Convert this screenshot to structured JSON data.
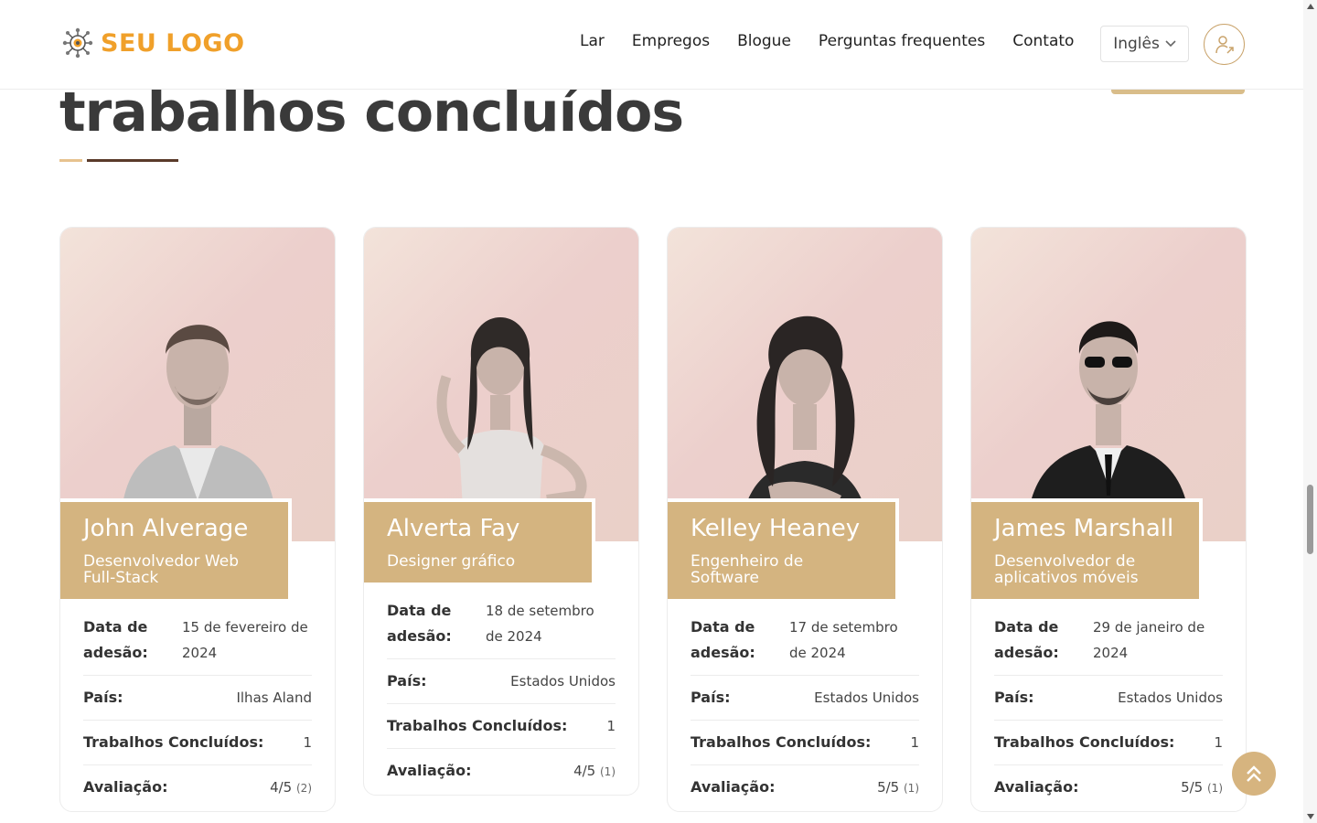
{
  "header": {
    "logo_text": "SEU LOGO",
    "nav": [
      "Lar",
      "Empregos",
      "Blogue",
      "Perguntas frequentes",
      "Contato"
    ],
    "language": "Inglês"
  },
  "section": {
    "title": "trabalhos concluídos"
  },
  "labels": {
    "joined": "Data de adesão:",
    "country": "País:",
    "jobs": "Trabalhos Concluídos:",
    "rating": "Avaliação:"
  },
  "cards": [
    {
      "name": "John Alverage",
      "role": "Desenvolvedor Web Full-Stack",
      "joined": "15 de fevereiro de 2024",
      "country": "Ilhas Aland",
      "jobs": "1",
      "rating": "4/5",
      "reviews": "(2)"
    },
    {
      "name": "Alverta Fay",
      "role": "Designer gráfico",
      "joined": "18 de setembro de 2024",
      "country": "Estados Unidos",
      "jobs": "1",
      "rating": "4/5",
      "reviews": "(1)"
    },
    {
      "name": "Kelley Heaney",
      "role": "Engenheiro de Software",
      "joined": "17 de setembro de 2024",
      "country": "Estados Unidos",
      "jobs": "1",
      "rating": "5/5",
      "reviews": "(1)"
    },
    {
      "name": "James Marshall",
      "role": "Desenvolvedor de aplicativos móveis",
      "joined": "29 de janeiro de 2024",
      "country": "Estados Unidos",
      "jobs": "1",
      "rating": "5/5",
      "reviews": "(1)"
    }
  ],
  "colors": {
    "accent": "#d4b480",
    "logo": "#f0a02a",
    "dark": "#5a3a2a"
  }
}
